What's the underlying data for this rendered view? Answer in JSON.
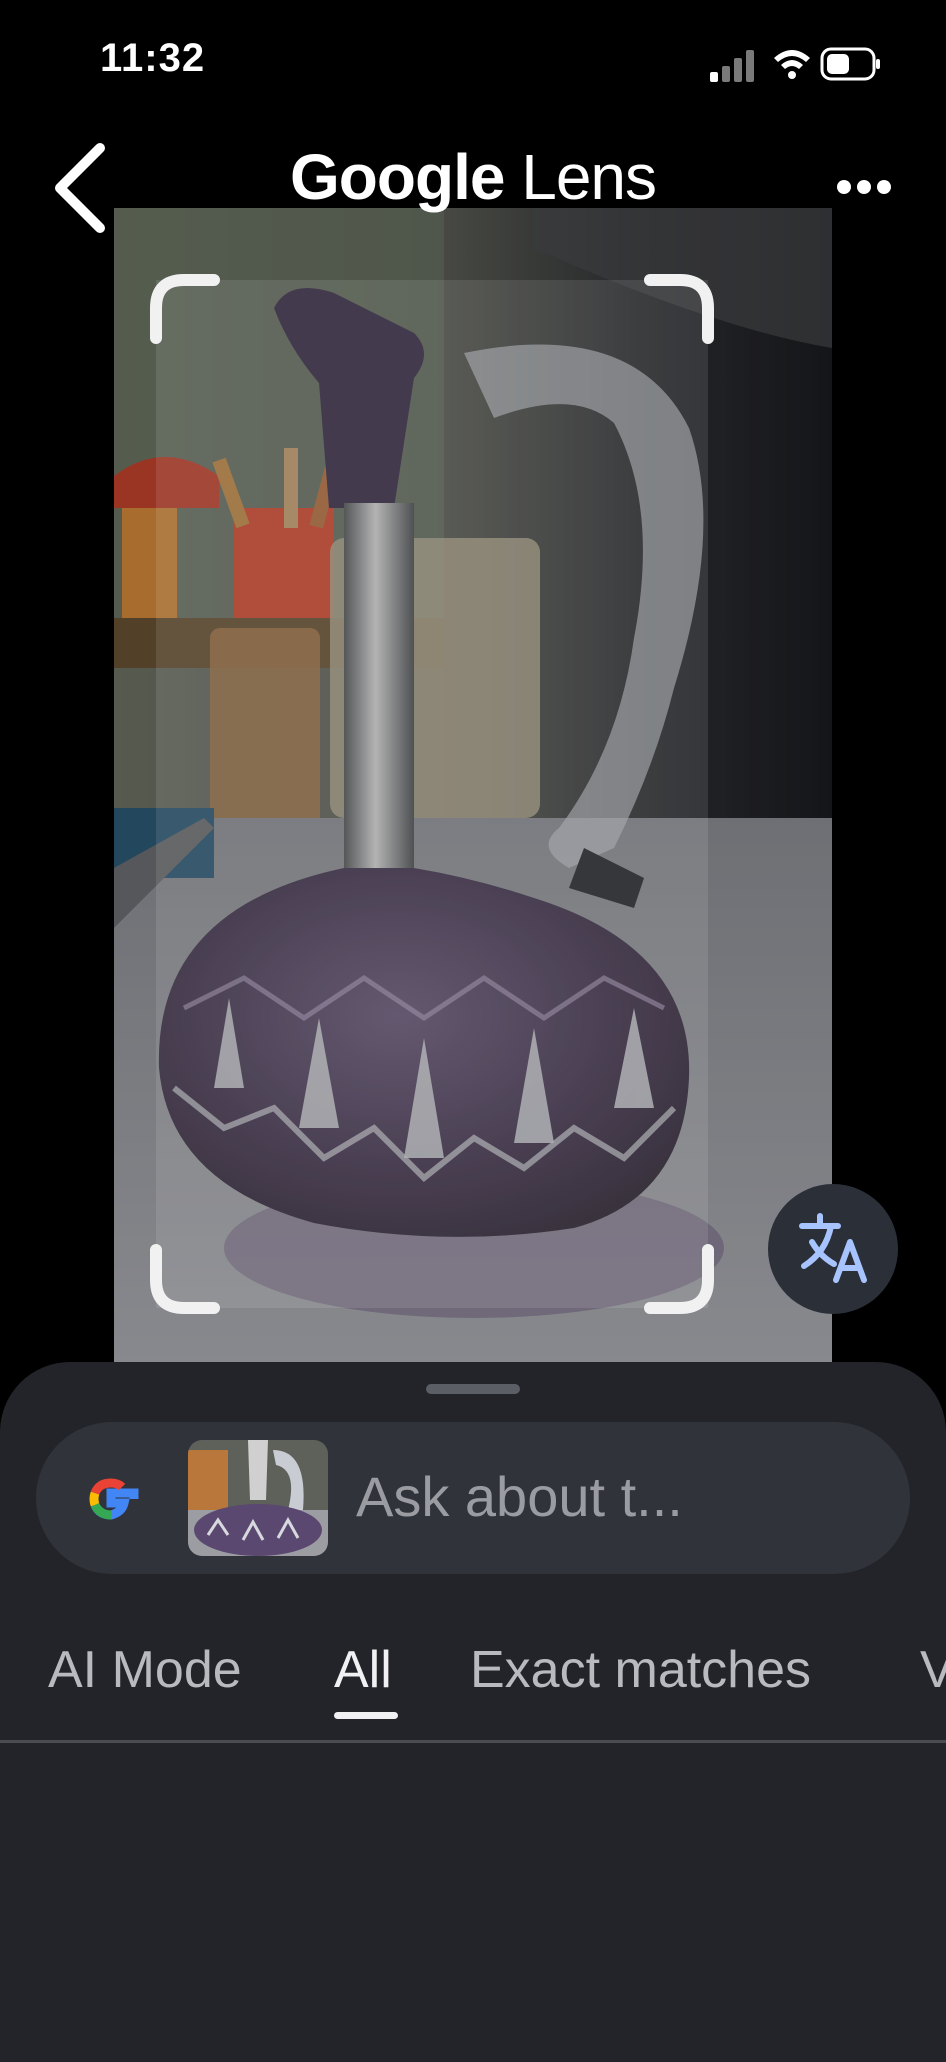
{
  "status": {
    "time": "11:32"
  },
  "header": {
    "title_brand": "Google",
    "title_product": "Lens"
  },
  "search": {
    "placeholder": "Ask about t..."
  },
  "tabs": [
    {
      "label": "AI Mode",
      "active": false
    },
    {
      "label": "All",
      "active": true
    },
    {
      "label": "Exact matches",
      "active": false
    },
    {
      "label": "V",
      "active": false
    }
  ],
  "icons": {
    "back": "chevron-left-icon",
    "more": "more-horizontal-icon",
    "translate": "translate-icon",
    "google": "google-g-icon"
  },
  "colors": {
    "background": "#000000",
    "sheet": "#222429",
    "pill": "#30333a",
    "translate_glyph": "#a8c4ff",
    "decanter": "#4b3a5c"
  }
}
